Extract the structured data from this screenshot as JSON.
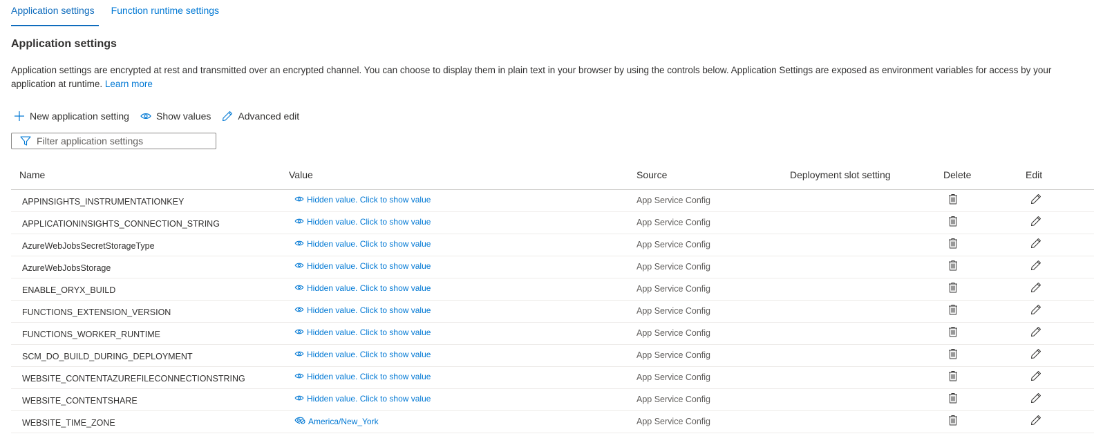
{
  "tabs": [
    {
      "label": "Application settings",
      "active": true
    },
    {
      "label": "Function runtime settings",
      "active": false
    }
  ],
  "section_title": "Application settings",
  "description": {
    "text": "Application settings are encrypted at rest and transmitted over an encrypted channel. You can choose to display them in plain text in your browser by using the controls below. Application Settings are exposed as environment variables for access by your application at runtime.",
    "link": "Learn more"
  },
  "toolbar": {
    "new_label": "New application setting",
    "show_values_label": "Show values",
    "advanced_edit_label": "Advanced edit"
  },
  "filter": {
    "placeholder": "Filter application settings",
    "value": ""
  },
  "colors": {
    "accent": "#0078d4",
    "text": "#323130",
    "muted": "#605e5c"
  },
  "table": {
    "headers": {
      "name": "Name",
      "value": "Value",
      "source": "Source",
      "slot": "Deployment slot setting",
      "delete": "Delete",
      "edit": "Edit"
    },
    "rows": [
      {
        "name": "APPINSIGHTS_INSTRUMENTATIONKEY",
        "value": "Hidden value. Click to show value",
        "hidden": true,
        "source": "App Service Config",
        "slot": ""
      },
      {
        "name": "APPLICATIONINSIGHTS_CONNECTION_STRING",
        "value": "Hidden value. Click to show value",
        "hidden": true,
        "source": "App Service Config",
        "slot": ""
      },
      {
        "name": "AzureWebJobsSecretStorageType",
        "value": "Hidden value. Click to show value",
        "hidden": true,
        "source": "App Service Config",
        "slot": ""
      },
      {
        "name": "AzureWebJobsStorage",
        "value": "Hidden value. Click to show value",
        "hidden": true,
        "source": "App Service Config",
        "slot": ""
      },
      {
        "name": "ENABLE_ORYX_BUILD",
        "value": "Hidden value. Click to show value",
        "hidden": true,
        "source": "App Service Config",
        "slot": ""
      },
      {
        "name": "FUNCTIONS_EXTENSION_VERSION",
        "value": "Hidden value. Click to show value",
        "hidden": true,
        "source": "App Service Config",
        "slot": ""
      },
      {
        "name": "FUNCTIONS_WORKER_RUNTIME",
        "value": "Hidden value. Click to show value",
        "hidden": true,
        "source": "App Service Config",
        "slot": ""
      },
      {
        "name": "SCM_DO_BUILD_DURING_DEPLOYMENT",
        "value": "Hidden value. Click to show value",
        "hidden": true,
        "source": "App Service Config",
        "slot": ""
      },
      {
        "name": "WEBSITE_CONTENTAZUREFILECONNECTIONSTRING",
        "value": "Hidden value. Click to show value",
        "hidden": true,
        "source": "App Service Config",
        "slot": ""
      },
      {
        "name": "WEBSITE_CONTENTSHARE",
        "value": "Hidden value. Click to show value",
        "hidden": true,
        "source": "App Service Config",
        "slot": ""
      },
      {
        "name": "WEBSITE_TIME_ZONE",
        "value": "America/New_York",
        "hidden": false,
        "source": "App Service Config",
        "slot": ""
      }
    ]
  }
}
